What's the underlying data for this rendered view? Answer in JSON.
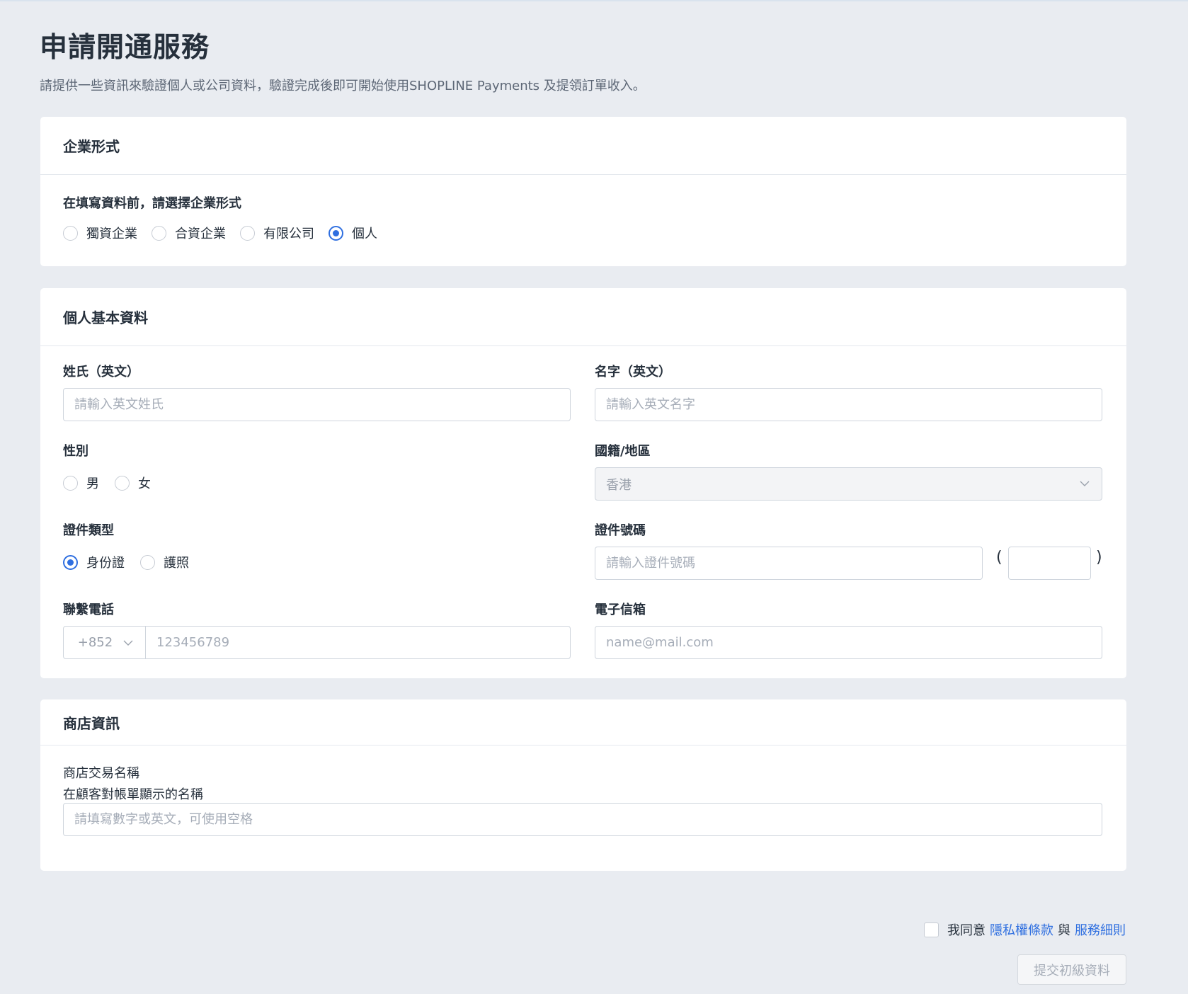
{
  "page": {
    "title": "申請開通服務",
    "description": "請提供一些資訊來驗證個人或公司資料，驗證完成後即可開始使用SHOPLINE Payments 及提領訂單收入。"
  },
  "business_type": {
    "header": "企業形式",
    "prompt": "在填寫資料前，請選擇企業形式",
    "options": [
      "獨資企業",
      "合資企業",
      "有限公司",
      "個人"
    ],
    "selected": "個人"
  },
  "personal_info": {
    "header": "個人基本資料",
    "last_name": {
      "label": "姓氏（英文）",
      "placeholder": "請輸入英文姓氏",
      "value": ""
    },
    "first_name": {
      "label": "名字（英文）",
      "placeholder": "請輸入英文名字",
      "value": ""
    },
    "gender": {
      "label": "性別",
      "options": [
        "男",
        "女"
      ],
      "selected": ""
    },
    "nationality": {
      "label": "國籍/地區",
      "value": "香港"
    },
    "id_type": {
      "label": "證件類型",
      "options": [
        "身份證",
        "護照"
      ],
      "selected": "身份證"
    },
    "id_number": {
      "label": "證件號碼",
      "placeholder": "請輸入證件號碼",
      "open_paren": "(",
      "close_paren": ")",
      "check_digit": ""
    },
    "phone": {
      "label": "聯繫電話",
      "country_code": "+852",
      "placeholder": "123456789"
    },
    "email": {
      "label": "電子信箱",
      "placeholder": "name@mail.com"
    }
  },
  "shop_info": {
    "header": "商店資訊",
    "name_label": "商店交易名稱",
    "name_hint": "在顧客對帳單顯示的名稱",
    "name_placeholder": "請填寫數字或英文，可使用空格"
  },
  "footer": {
    "agree_prefix": "我同意",
    "privacy_link": "隱私權條款",
    "and": "與",
    "terms_link": "服務細則",
    "submit_label": "提交初級資料"
  },
  "colors": {
    "accent": "#2f6fe0",
    "background": "#e9ecf1"
  }
}
